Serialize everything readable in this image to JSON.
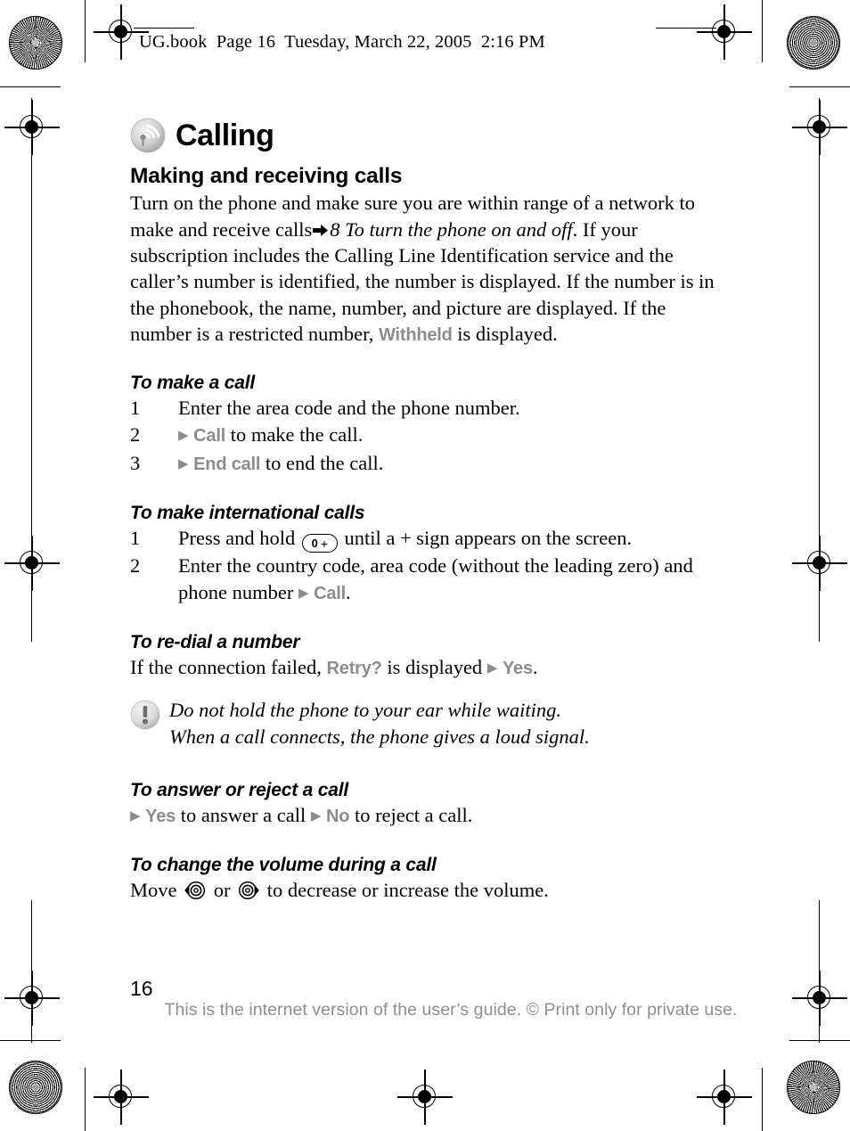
{
  "header": {
    "text": "UG.book  Page 16  Tuesday, March 22, 2005  2:16 PM"
  },
  "chapter": {
    "icon": "radio-waves-icon",
    "title": "Calling"
  },
  "sections": {
    "making_receiving": {
      "heading": "Making and receiving calls",
      "para_1": "Turn on the phone and make sure you are within range of a network to make and receive calls",
      "xref_icon": "right-block-arrow-icon",
      "xref_text": "8 To turn the phone on and off",
      "para_2": ". If your subscription includes the Calling Line Identification service and the caller’s number is identified, the number is displayed. If the number is in the phonebook, the name, number, and picture are displayed. If the number is a restricted number, ",
      "withheld_label": "Withheld",
      "para_3": " is displayed."
    },
    "make_a_call": {
      "heading": "To make a call",
      "steps": [
        {
          "num": "1",
          "text": "Enter the area code and the phone number."
        },
        {
          "num": "2",
          "arrow": "▶",
          "label": "Call",
          "text": " to make the call."
        },
        {
          "num": "3",
          "arrow": "▶",
          "label": "End call",
          "text": " to end the call."
        }
      ]
    },
    "international": {
      "heading": "To make international calls",
      "step_1_pre": "Press and hold",
      "key_zero": "0",
      "key_plus": "+",
      "step_1_post": "until a + sign appears on the screen.",
      "step_2_pre": "Enter the country code, area code (without the leading zero) and phone number ",
      "step_2_arrow": "▶",
      "step_2_label": "Call",
      "step_2_post": "."
    },
    "redial": {
      "heading": "To re-dial a number",
      "text_pre": "If the connection failed, ",
      "retry_label": "Retry?",
      "text_mid": " is displayed ",
      "yes_arrow": "▶",
      "yes_label": "Yes",
      "text_post": "."
    },
    "note": {
      "icon": "exclamation-circle-icon",
      "line_1": "Do not hold the phone to your ear while waiting.",
      "line_2": "When a call connects, the phone gives a loud signal."
    },
    "answer_reject": {
      "heading": "To answer or reject a call",
      "arrow_1": "▶",
      "yes_label": "Yes",
      "text_mid": " to answer a call ",
      "arrow_2": "▶",
      "no_label": "No",
      "text_post": " to reject a call."
    },
    "volume": {
      "heading": "To change the volume during a call",
      "text_pre": "Move ",
      "key_left": "nav-key-left-icon",
      "text_mid": " or ",
      "key_right": "nav-key-right-icon",
      "text_post": " to decrease or increase the volume."
    }
  },
  "footer": {
    "page_number": "16",
    "watermark": "This is the internet version of the user’s guide. © Print only for private use."
  },
  "colors": {
    "ui_label_grey": "#8c8c8c",
    "watermark_grey": "#8f8f8f",
    "text_black": "#000000"
  }
}
